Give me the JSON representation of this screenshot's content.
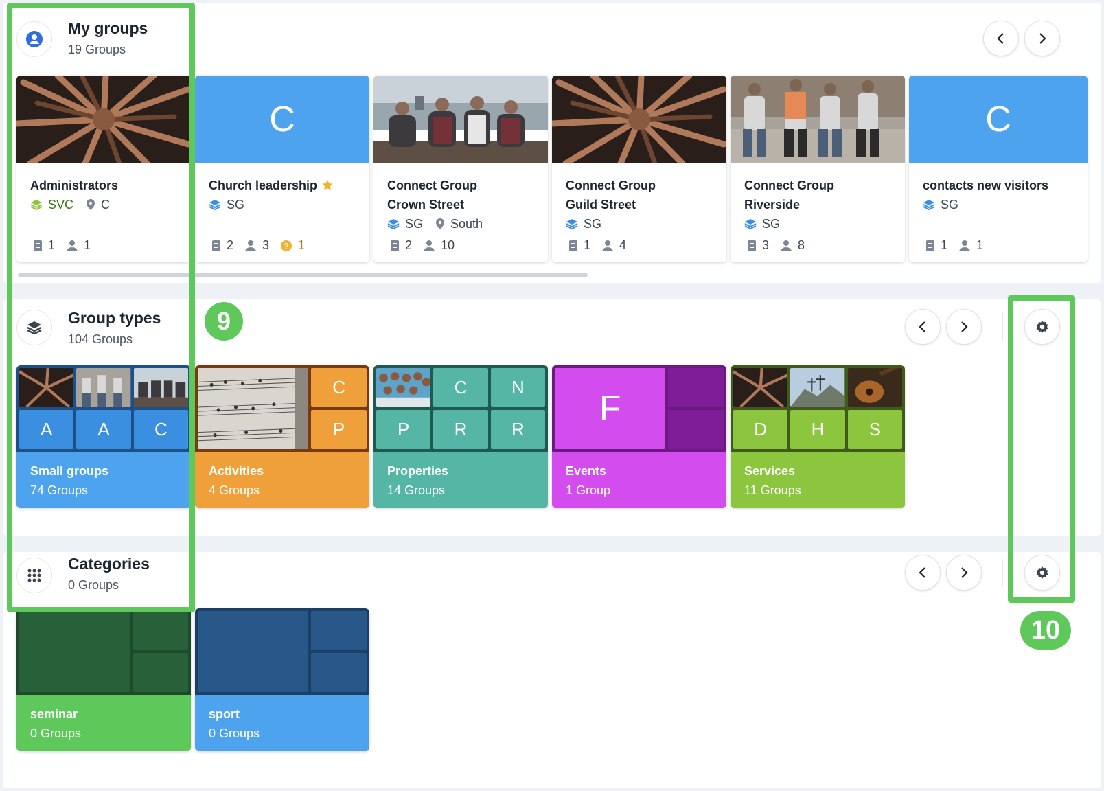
{
  "my_groups": {
    "title": "My groups",
    "subtitle": "19 Groups",
    "icon": "user-circle-icon",
    "cards": [
      {
        "name_line1": "Administrators",
        "name_line2": "",
        "type": "SVC",
        "type_color": "#8cc63f",
        "location": "C",
        "stat_a": "1",
        "stat_b": "1",
        "stat_c": "",
        "letter": ""
      },
      {
        "name_line1": "Church leadership",
        "name_line2": "",
        "type": "SG",
        "type_color": "#3b8fe0",
        "location": "",
        "stat_a": "2",
        "stat_b": "3",
        "stat_c": "1",
        "letter": "C"
      },
      {
        "name_line1": "Connect Group",
        "name_line2": "Crown Street",
        "type": "SG",
        "type_color": "#3b8fe0",
        "location": "South",
        "stat_a": "2",
        "stat_b": "10",
        "stat_c": "",
        "letter": ""
      },
      {
        "name_line1": "Connect Group",
        "name_line2": "Guild Street",
        "type": "SG",
        "type_color": "#3b8fe0",
        "location": "",
        "stat_a": "1",
        "stat_b": "4",
        "stat_c": "",
        "letter": ""
      },
      {
        "name_line1": "Connect Group",
        "name_line2": "Riverside",
        "type": "SG",
        "type_color": "#3b8fe0",
        "location": "",
        "stat_a": "3",
        "stat_b": "8",
        "stat_c": "",
        "letter": ""
      },
      {
        "name_line1": "contacts new visitors",
        "name_line2": "",
        "type": "SG",
        "type_color": "#3b8fe0",
        "location": "",
        "stat_a": "1",
        "stat_b": "1",
        "stat_c": "",
        "letter": "C"
      }
    ]
  },
  "group_types": {
    "title": "Group types",
    "subtitle": "104 Groups",
    "icon": "layers-icon",
    "cards": [
      {
        "name": "Small groups",
        "count": "74 Groups",
        "color": "#4ea3ee",
        "tiles": [
          "A",
          "A",
          "C"
        ]
      },
      {
        "name": "Activities",
        "count": "4 Groups",
        "color": "#f0a03a",
        "tiles": [
          "C",
          "P"
        ]
      },
      {
        "name": "Properties",
        "count": "14 Groups",
        "color": "#55b6a6",
        "tiles": [
          "C",
          "N",
          "P",
          "R",
          "R"
        ]
      },
      {
        "name": "Events",
        "count": "1 Group",
        "color": "#d34ced",
        "tiles": [
          "F"
        ]
      },
      {
        "name": "Services",
        "count": "11 Groups",
        "color": "#8cc63f",
        "tiles": [
          "D",
          "H",
          "S"
        ]
      }
    ]
  },
  "categories": {
    "title": "Categories",
    "subtitle": "0 Groups",
    "icon": "grid-dots-icon",
    "cards": [
      {
        "name": "seminar",
        "count": "0 Groups",
        "color": "#5ec95a",
        "dark": "#28603a"
      },
      {
        "name": "sport",
        "count": "0 Groups",
        "color": "#4ea3ee",
        "dark": "#28578a"
      }
    ]
  },
  "annotations": {
    "badge_9": "9",
    "badge_10": "10",
    "highlight_color": "#5ec95a"
  }
}
